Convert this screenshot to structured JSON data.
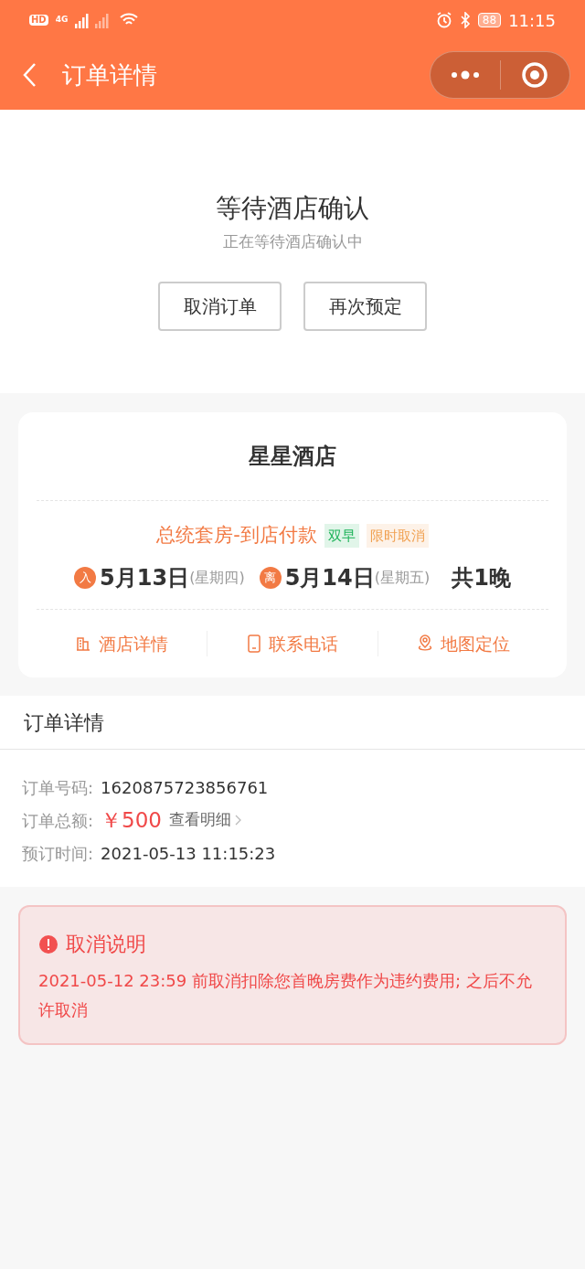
{
  "status_bar": {
    "hd": "HD",
    "network": "4G",
    "battery": "88",
    "time": "11:15"
  },
  "nav": {
    "title": "订单详情"
  },
  "status": {
    "title": "等待酒店确认",
    "subtitle": "正在等待酒店确认中",
    "buttons": [
      "取消订单",
      "再次预定"
    ]
  },
  "hotel": {
    "name": "星星酒店",
    "room": "总统套房-到店付款",
    "tags": [
      {
        "label": "双早",
        "color": "#1fb35a"
      },
      {
        "label": "限时取消",
        "color": "#f0a050"
      }
    ],
    "checkin": {
      "badge": "入",
      "date": "5月13日",
      "weekday": "(星期四)"
    },
    "checkout": {
      "badge": "离",
      "date": "5月14日",
      "weekday": "(星期五)"
    },
    "nights": "共1晚",
    "actions": [
      {
        "kind": "building",
        "label": "酒店详情"
      },
      {
        "kind": "phone",
        "label": "联系电话"
      },
      {
        "kind": "map",
        "label": "地图定位"
      }
    ]
  },
  "order": {
    "title": "订单详情",
    "rows": [
      {
        "kind": "text",
        "label": "订单号码:",
        "value": "1620875723856761"
      },
      {
        "kind": "price",
        "label": "订单总额:",
        "value": "￥500",
        "link": "查看明细"
      },
      {
        "kind": "text",
        "label": "预订时间:",
        "value": "2021-05-13 11:15:23"
      }
    ]
  },
  "cancel_notice": {
    "title": "取消说明",
    "text": "2021-05-12 23:59 前取消扣除您首晚房费作为违约费用; 之后不允许取消"
  }
}
